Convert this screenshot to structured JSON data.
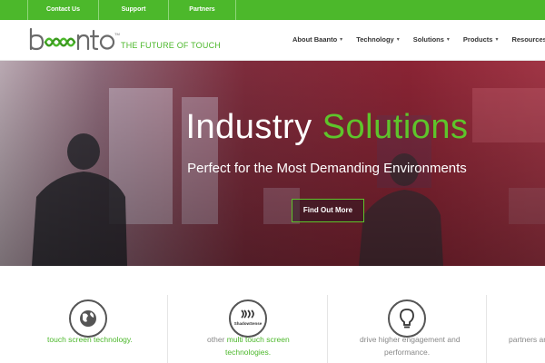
{
  "topbar": {
    "links": [
      "Contact Us",
      "Support",
      "Partners"
    ]
  },
  "header": {
    "logo_text": "baanto",
    "logo_tm": "TM",
    "tagline": "THE FUTURE OF TOUCH",
    "nav": [
      {
        "label": "About Baanto",
        "icon": "chevron-down-icon"
      },
      {
        "label": "Technology",
        "icon": "chevron-down-icon"
      },
      {
        "label": "Solutions",
        "icon": "chevron-down-icon"
      },
      {
        "label": "Products",
        "icon": "chevron-down-icon"
      },
      {
        "label": "Resources",
        "icon": "chevron-down-icon"
      }
    ]
  },
  "hero": {
    "title_part1": "Industry",
    "title_part2": "Solutions",
    "subtitle": "Perfect for the Most Demanding Environments",
    "cta_label": "Find Out More"
  },
  "features": [
    {
      "icon": "globe-icon",
      "lines": [
        "touch screen technology."
      ],
      "accent": "green"
    },
    {
      "icon": "shadowsense-logo-icon",
      "icon_text": "ShadowSense",
      "line1_gray": "other ",
      "line1_green": "multi touch screen",
      "line2_green": "technologies."
    },
    {
      "icon": "lightbulb-icon",
      "lines": [
        "drive higher engagement and",
        "performance."
      ],
      "accent": "gray"
    },
    {
      "icon": "",
      "lines": [
        "partners and"
      ],
      "accent": "gray"
    }
  ],
  "colors": {
    "brand_green": "#4cb82b",
    "hero_green": "#5ec42b",
    "text_dark": "#333333",
    "text_gray": "#888888"
  }
}
